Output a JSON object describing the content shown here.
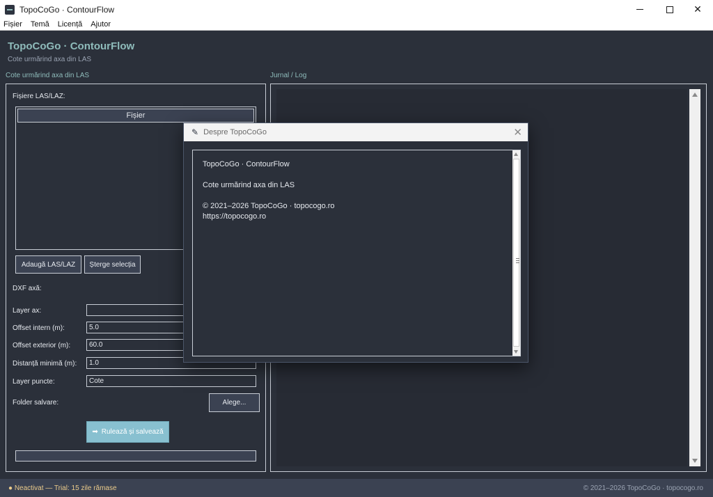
{
  "window": {
    "title": "TopoCoGo · ContourFlow"
  },
  "menu": {
    "items": [
      "Fișier",
      "Temă",
      "Licență",
      "Ajutor"
    ]
  },
  "header": {
    "title": "TopoCoGo · ContourFlow",
    "subtitle": "Cote urmărind axa din LAS"
  },
  "left_panel": {
    "section_label": "Cote urmărind axa din LAS",
    "files_label": "Fișiere LAS/LAZ:",
    "list_column": "Fișier",
    "add_button": "Adaugă LAS/LAZ",
    "delete_button": "Șterge selecția",
    "dxf_label": "DXF axă:",
    "fields": [
      {
        "label": "Layer ax:",
        "value": ""
      },
      {
        "label": "Offset intern (m):",
        "value": "5.0"
      },
      {
        "label": "Offset exterior (m):",
        "value": "60.0"
      },
      {
        "label": "Distanță minimă (m):",
        "value": "1.0"
      },
      {
        "label": "Layer puncte:",
        "value": "Cote"
      }
    ],
    "folder_label": "Folder salvare:",
    "choose_button": "Alege...",
    "run_button": "Rulează și salvează",
    "run_icon": "arrow-right-icon",
    "progress": 0
  },
  "right_panel": {
    "section_label": "Jurnal / Log"
  },
  "status": {
    "left": "● Neactivat — Trial: 15 zile rămase",
    "right": "© 2021–2026 TopoCoGo · topocogo.ro"
  },
  "dialog": {
    "title": "Despre TopoCoGo",
    "lines": [
      "TopoCoGo · ContourFlow",
      "Cote urmărind axa din LAS",
      "© 2021–2026 TopoCoGo · topocogo.ro",
      "https://topocogo.ro"
    ]
  },
  "colors": {
    "background": "#2b303a",
    "accent": "#8fbcbb",
    "run_button": "#88c0d0",
    "status_warning": "#ebcb8b"
  }
}
